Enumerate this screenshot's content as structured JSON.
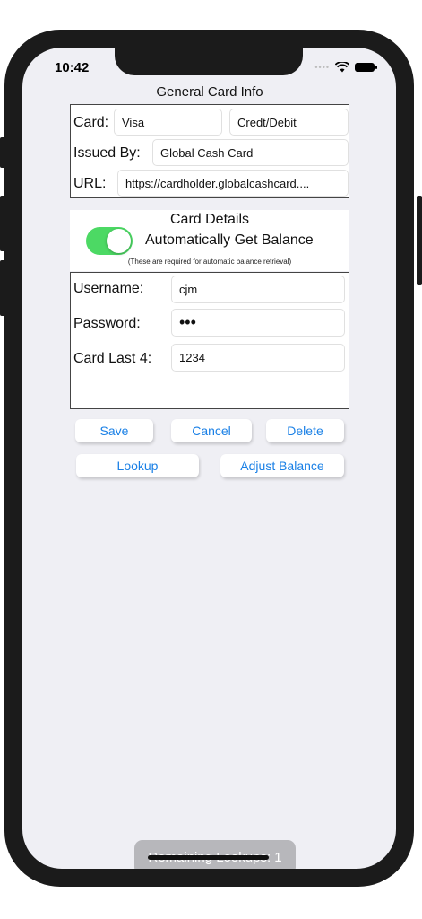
{
  "status_bar": {
    "time": "10:42",
    "signal": "••••"
  },
  "general": {
    "title": "General Card Info",
    "card_label": "Card:",
    "card_value": "Visa",
    "card_type_value": "Credt/Debit",
    "issued_label": "Issued By:",
    "issued_value": "Global Cash Card",
    "url_label": "URL:",
    "url_value": "https://cardholder.globalcashcard...."
  },
  "details": {
    "title": "Card Details",
    "auto_label": "Automatically Get Balance",
    "auto_enabled": true,
    "note": "(These are required for automatic balance retrieval)"
  },
  "credentials": {
    "username_label": "Username:",
    "username_value": "cjm",
    "password_label": "Password:",
    "password_value": "•••",
    "last4_label": "Card Last 4:",
    "last4_value": "1234"
  },
  "actions": {
    "save": "Save",
    "cancel": "Cancel",
    "delete": "Delete",
    "lookup": "Lookup",
    "adjust_balance": "Adjust Balance"
  },
  "footer": {
    "remaining_lookups": "Remaining Lookups: 1"
  },
  "colors": {
    "accent": "#1a80e6",
    "toggle_on": "#4cd964",
    "background": "#efeff4"
  }
}
